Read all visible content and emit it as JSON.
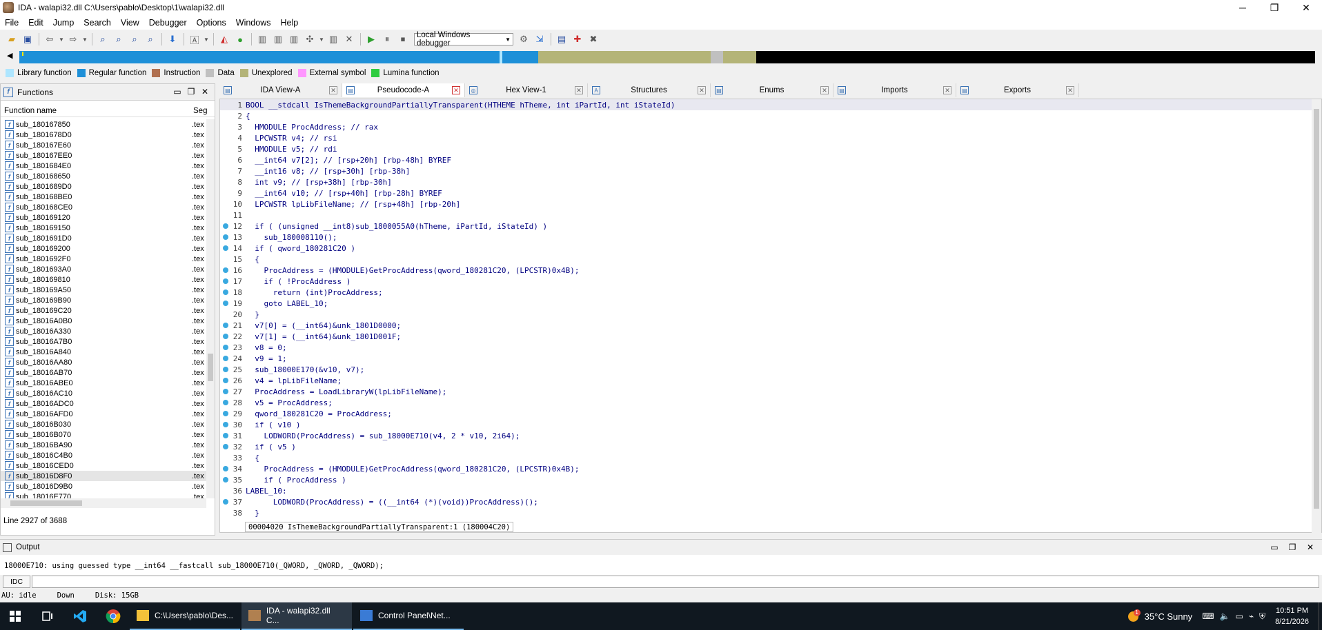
{
  "window": {
    "title": "IDA - walapi32.dll C:\\Users\\pablo\\Desktop\\1\\walapi32.dll",
    "minimize": "─",
    "maximize": "❐",
    "close": "✕"
  },
  "menu": [
    "File",
    "Edit",
    "Jump",
    "Search",
    "View",
    "Debugger",
    "Options",
    "Windows",
    "Help"
  ],
  "toolbar": {
    "debugger_select": "Local Windows debugger"
  },
  "legend": [
    {
      "label": "Library function",
      "color": "#aee6ff"
    },
    {
      "label": "Regular function",
      "color": "#1e90d8"
    },
    {
      "label": "Instruction",
      "color": "#b07050"
    },
    {
      "label": "Data",
      "color": "#c0c0c0"
    },
    {
      "label": "Unexplored",
      "color": "#b4b478"
    },
    {
      "label": "External symbol",
      "color": "#ff96ff"
    },
    {
      "label": "Lumina function",
      "color": "#2ecc40"
    }
  ],
  "functions_panel": {
    "title": "Functions",
    "col_name": "Function name",
    "col_seg": "Seg",
    "rows": [
      {
        "name": "sub_180167850",
        "seg": ".tex"
      },
      {
        "name": "sub_1801678D0",
        "seg": ".tex"
      },
      {
        "name": "sub_180167E60",
        "seg": ".tex"
      },
      {
        "name": "sub_180167EE0",
        "seg": ".tex"
      },
      {
        "name": "sub_1801684E0",
        "seg": ".tex"
      },
      {
        "name": "sub_180168650",
        "seg": ".tex"
      },
      {
        "name": "sub_1801689D0",
        "seg": ".tex"
      },
      {
        "name": "sub_180168BE0",
        "seg": ".tex"
      },
      {
        "name": "sub_180168CE0",
        "seg": ".tex"
      },
      {
        "name": "sub_180169120",
        "seg": ".tex"
      },
      {
        "name": "sub_180169150",
        "seg": ".tex"
      },
      {
        "name": "sub_1801691D0",
        "seg": ".tex"
      },
      {
        "name": "sub_180169200",
        "seg": ".tex"
      },
      {
        "name": "sub_1801692F0",
        "seg": ".tex"
      },
      {
        "name": "sub_1801693A0",
        "seg": ".tex"
      },
      {
        "name": "sub_180169810",
        "seg": ".tex"
      },
      {
        "name": "sub_180169A50",
        "seg": ".tex"
      },
      {
        "name": "sub_180169B90",
        "seg": ".tex"
      },
      {
        "name": "sub_180169C20",
        "seg": ".tex"
      },
      {
        "name": "sub_18016A0B0",
        "seg": ".tex"
      },
      {
        "name": "sub_18016A330",
        "seg": ".tex"
      },
      {
        "name": "sub_18016A7B0",
        "seg": ".tex"
      },
      {
        "name": "sub_18016A840",
        "seg": ".tex"
      },
      {
        "name": "sub_18016AA80",
        "seg": ".tex"
      },
      {
        "name": "sub_18016AB70",
        "seg": ".tex"
      },
      {
        "name": "sub_18016ABE0",
        "seg": ".tex"
      },
      {
        "name": "sub_18016AC10",
        "seg": ".tex"
      },
      {
        "name": "sub_18016ADC0",
        "seg": ".tex"
      },
      {
        "name": "sub_18016AFD0",
        "seg": ".tex"
      },
      {
        "name": "sub_18016B030",
        "seg": ".tex"
      },
      {
        "name": "sub_18016B070",
        "seg": ".tex"
      },
      {
        "name": "sub_18016BA90",
        "seg": ".tex"
      },
      {
        "name": "sub_18016C4B0",
        "seg": ".tex"
      },
      {
        "name": "sub_18016CED0",
        "seg": ".tex"
      },
      {
        "name": "sub_18016D8F0",
        "seg": ".tex",
        "selected": true
      },
      {
        "name": "sub_18016D9B0",
        "seg": ".tex"
      },
      {
        "name": "sub_18016E770",
        "seg": ".tex"
      }
    ],
    "status": "Line 2927 of 3688"
  },
  "tabs": [
    {
      "label": "IDA View-A",
      "icon": "ida-view-icon"
    },
    {
      "label": "Pseudocode-A",
      "icon": "pseudocode-icon",
      "active": true
    },
    {
      "label": "Hex View-1",
      "icon": "hex-view-icon"
    },
    {
      "label": "Structures",
      "icon": "structures-icon"
    },
    {
      "label": "Enums",
      "icon": "enums-icon"
    },
    {
      "label": "Imports",
      "icon": "imports-icon"
    },
    {
      "label": "Exports",
      "icon": "exports-icon"
    }
  ],
  "code": [
    {
      "n": "1",
      "dot": false,
      "t": "BOOL __stdcall IsThemeBackgroundPartiallyTransparent(HTHEME hTheme, int iPartId, int iStateId)"
    },
    {
      "n": "2",
      "dot": false,
      "t": "{"
    },
    {
      "n": "3",
      "dot": false,
      "t": "  HMODULE ProcAddress; // rax"
    },
    {
      "n": "4",
      "dot": false,
      "t": "  LPCWSTR v4; // rsi"
    },
    {
      "n": "5",
      "dot": false,
      "t": "  HMODULE v5; // rdi"
    },
    {
      "n": "6",
      "dot": false,
      "t": "  __int64 v7[2]; // [rsp+20h] [rbp-48h] BYREF"
    },
    {
      "n": "7",
      "dot": false,
      "t": "  __int16 v8; // [rsp+30h] [rbp-38h]"
    },
    {
      "n": "8",
      "dot": false,
      "t": "  int v9; // [rsp+38h] [rbp-30h]"
    },
    {
      "n": "9",
      "dot": false,
      "t": "  __int64 v10; // [rsp+40h] [rbp-28h] BYREF"
    },
    {
      "n": "10",
      "dot": false,
      "t": "  LPCWSTR lpLibFileName; // [rsp+48h] [rbp-20h]"
    },
    {
      "n": "11",
      "dot": false,
      "t": ""
    },
    {
      "n": "12",
      "dot": true,
      "t": "  if ( (unsigned __int8)sub_1800055A0(hTheme, iPartId, iStateId) )"
    },
    {
      "n": "13",
      "dot": true,
      "t": "    sub_180008110();"
    },
    {
      "n": "14",
      "dot": true,
      "t": "  if ( qword_180281C20 )"
    },
    {
      "n": "15",
      "dot": false,
      "t": "  {"
    },
    {
      "n": "16",
      "dot": true,
      "t": "    ProcAddress = (HMODULE)GetProcAddress(qword_180281C20, (LPCSTR)0x4B);"
    },
    {
      "n": "17",
      "dot": true,
      "t": "    if ( !ProcAddress )"
    },
    {
      "n": "18",
      "dot": true,
      "t": "      return (int)ProcAddress;"
    },
    {
      "n": "19",
      "dot": true,
      "t": "    goto LABEL_10;"
    },
    {
      "n": "20",
      "dot": false,
      "t": "  }"
    },
    {
      "n": "21",
      "dot": true,
      "t": "  v7[0] = (__int64)&unk_1801D0000;"
    },
    {
      "n": "22",
      "dot": true,
      "t": "  v7[1] = (__int64)&unk_1801D001F;"
    },
    {
      "n": "23",
      "dot": true,
      "t": "  v8 = 0;"
    },
    {
      "n": "24",
      "dot": true,
      "t": "  v9 = 1;"
    },
    {
      "n": "25",
      "dot": true,
      "t": "  sub_18000E170(&v10, v7);"
    },
    {
      "n": "26",
      "dot": true,
      "t": "  v4 = lpLibFileName;"
    },
    {
      "n": "27",
      "dot": true,
      "t": "  ProcAddress = LoadLibraryW(lpLibFileName);"
    },
    {
      "n": "28",
      "dot": true,
      "t": "  v5 = ProcAddress;"
    },
    {
      "n": "29",
      "dot": true,
      "t": "  qword_180281C20 = ProcAddress;"
    },
    {
      "n": "30",
      "dot": true,
      "t": "  if ( v10 )"
    },
    {
      "n": "31",
      "dot": true,
      "t": "    LODWORD(ProcAddress) = sub_18000E710(v4, 2 * v10, 2i64);"
    },
    {
      "n": "32",
      "dot": true,
      "t": "  if ( v5 )"
    },
    {
      "n": "33",
      "dot": false,
      "t": "  {"
    },
    {
      "n": "34",
      "dot": true,
      "t": "    ProcAddress = (HMODULE)GetProcAddress(qword_180281C20, (LPCSTR)0x4B);"
    },
    {
      "n": "35",
      "dot": true,
      "t": "    if ( ProcAddress )"
    },
    {
      "n": "36",
      "dot": false,
      "t": "LABEL_10:"
    },
    {
      "n": "37",
      "dot": true,
      "t": "      LODWORD(ProcAddress) = ((__int64 (*)(void))ProcAddress)();"
    },
    {
      "n": "38",
      "dot": false,
      "t": "  }"
    }
  ],
  "code_status": "00004020 IsThemeBackgroundPartiallyTransparent:1 (180004C20)",
  "output": {
    "title": "Output",
    "text": "18000E710: using guessed type __int64 __fastcall sub_18000E710(_QWORD, _QWORD, _QWORD);"
  },
  "idc_button": "IDC",
  "statusbar": {
    "au": "AU:  idle",
    "dir": "Down",
    "disk": "Disk: 15GB"
  },
  "taskbar": {
    "apps": [
      {
        "label": "C:\\Users\\pablo\\Des...",
        "icon": "folder-icon"
      },
      {
        "label": "IDA - walapi32.dll C...",
        "icon": "ida-icon",
        "active": true
      },
      {
        "label": "Control Panel\\Net...",
        "icon": "control-panel-icon"
      }
    ],
    "weather": "35°C  Sunny",
    "time": "10:51 PM",
    "date": "8/21/2026",
    "badge": "1"
  }
}
